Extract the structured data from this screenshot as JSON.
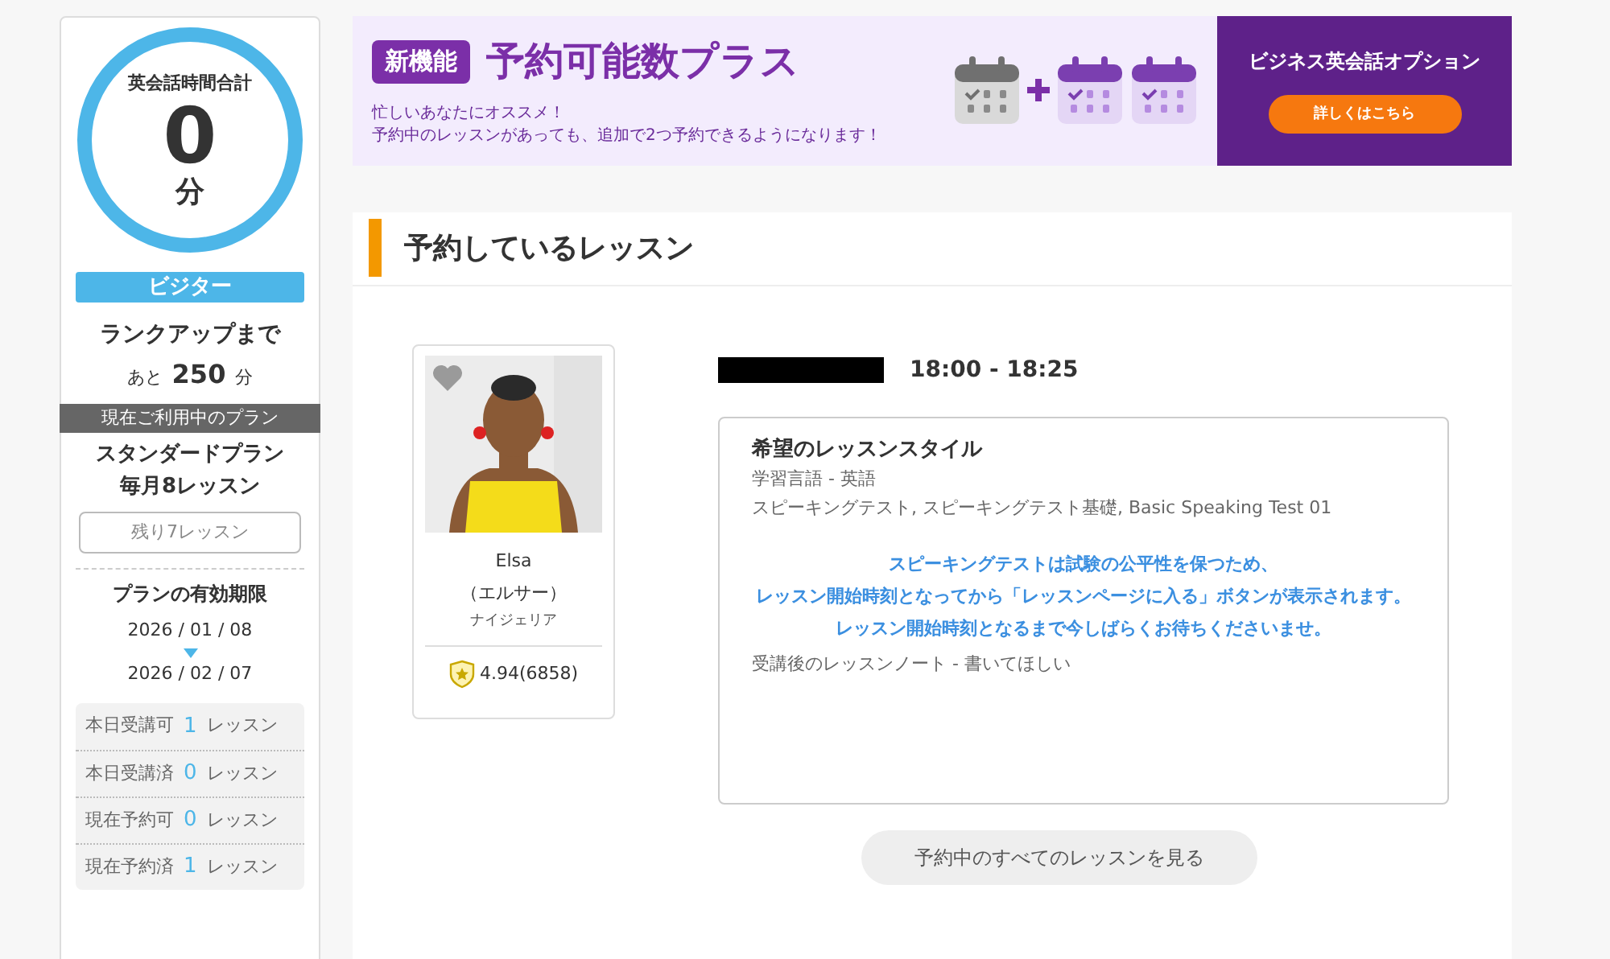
{
  "sidebar": {
    "total_label": "英会話時間合計",
    "total_value": "0",
    "total_unit": "分",
    "rank": "ビジター",
    "rankup_label": "ランクアップまで",
    "rankup_prefix": "あと",
    "rankup_value": "250",
    "rankup_unit": "分",
    "plan_header": "現在ご利用中のプラン",
    "plan_name": "スタンダードプラン",
    "plan_detail": "毎月8レッスン",
    "remaining": "残り7レッスン",
    "validity_label": "プランの有効期限",
    "validity_start": "2026 / 01 / 08",
    "validity_end": "2026 / 02 / 07",
    "stats": [
      {
        "label": "本日受講可",
        "count": "1",
        "unit": "レッスン"
      },
      {
        "label": "本日受講済",
        "count": "0",
        "unit": "レッスン"
      },
      {
        "label": "現在予約可",
        "count": "0",
        "unit": "レッスン"
      },
      {
        "label": "現在予約済",
        "count": "1",
        "unit": "レッスン"
      }
    ]
  },
  "banner": {
    "badge": "新機能",
    "title": "予約可能数プラス",
    "lines": [
      "忙しいあなたにオススメ！",
      "予約中のレッスンがあっても、追加で2つ予約できるようになります！"
    ],
    "option_title": "ビジネス英会話オプション",
    "option_button": "詳しくはこちら"
  },
  "section_title": "予約しているレッスン",
  "teacher": {
    "favorite": false,
    "name": "Elsa",
    "kana": "（エルサー）",
    "country": "ナイジェリア",
    "rating": "4.94(6858)"
  },
  "lesson": {
    "time": "18:00 - 18:25",
    "style_title": "希望のレッスンスタイル",
    "details": [
      "学習言語 - 英語",
      "スピーキングテスト, スピーキングテスト基礎, Basic Speaking Test 01"
    ],
    "notice": [
      "スピーキングテストは試験の公平性を保つため、",
      "レッスン開始時刻となってから「レッスンページに入る」ボタンが表示されます。",
      "レッスン開始時刻となるまで今しばらくお待ちくださいませ。"
    ],
    "note": "受講後のレッスンノート - 書いてほしい"
  },
  "all_lessons_button": "予約中のすべてのレッスンを見る"
}
